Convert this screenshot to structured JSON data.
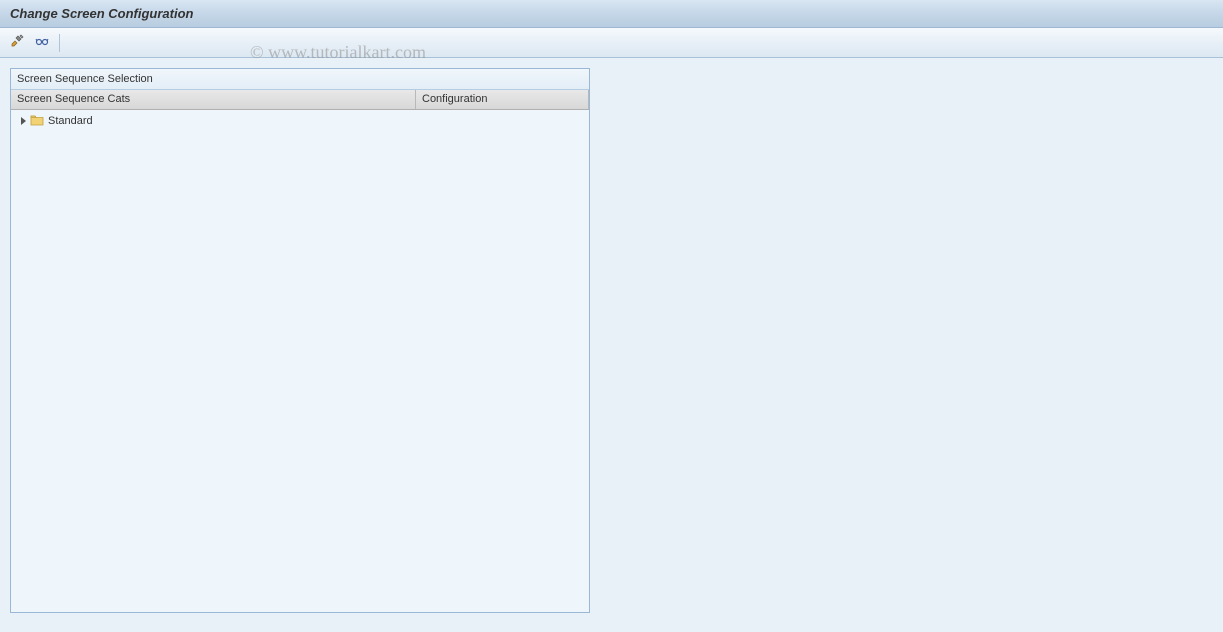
{
  "title": "Change Screen Configuration",
  "toolbar": {
    "tool1_name": "wrench-pencil-icon",
    "tool2_name": "glasses-icon"
  },
  "panel": {
    "title": "Screen Sequence Selection",
    "columns": {
      "cats": "Screen Sequence Cats",
      "config": "Configuration"
    },
    "tree": {
      "item0": {
        "label": "Standard",
        "config": ""
      }
    }
  },
  "watermark": "© www.tutorialkart.com"
}
